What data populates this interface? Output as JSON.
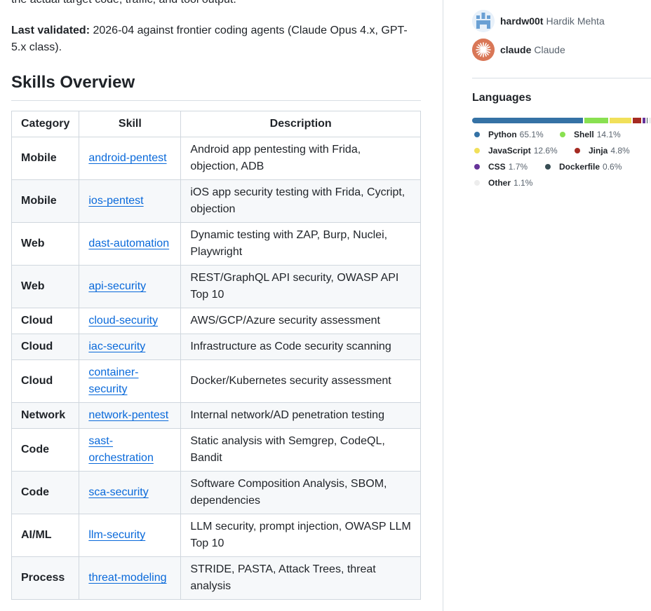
{
  "readme": {
    "cut_line": "the actual target code, traffic, and tool output.",
    "validated_label": "Last validated:",
    "validated_text": " 2026-04 against frontier coding agents (Claude Opus 4.x, GPT-5.x class).",
    "section_title": "Skills Overview",
    "table": {
      "headers": [
        "Category",
        "Skill",
        "Description"
      ],
      "rows": [
        {
          "category": "Mobile",
          "skill": "android-pentest",
          "description": "Android app pentesting with Frida, objection, ADB"
        },
        {
          "category": "Mobile",
          "skill": "ios-pentest",
          "description": "iOS app security testing with Frida, Cycript, objection"
        },
        {
          "category": "Web",
          "skill": "dast-automation",
          "description": "Dynamic testing with ZAP, Burp, Nuclei, Playwright"
        },
        {
          "category": "Web",
          "skill": "api-security",
          "description": "REST/GraphQL API security, OWASP API Top 10"
        },
        {
          "category": "Cloud",
          "skill": "cloud-security",
          "description": "AWS/GCP/Azure security assessment"
        },
        {
          "category": "Cloud",
          "skill": "iac-security",
          "description": "Infrastructure as Code security scanning"
        },
        {
          "category": "Cloud",
          "skill": "container-security",
          "description": "Docker/Kubernetes security assessment"
        },
        {
          "category": "Network",
          "skill": "network-pentest",
          "description": "Internal network/AD penetration testing"
        },
        {
          "category": "Code",
          "skill": "sast-orchestration",
          "description": "Static analysis with Semgrep, CodeQL, Bandit"
        },
        {
          "category": "Code",
          "skill": "sca-security",
          "description": "Software Composition Analysis, SBOM, dependencies"
        },
        {
          "category": "AI/ML",
          "skill": "llm-security",
          "description": "LLM security, prompt injection, OWASP LLM Top 10"
        },
        {
          "category": "Process",
          "skill": "threat-modeling",
          "description": "STRIDE, PASTA, Attack Trees, threat analysis"
        }
      ]
    }
  },
  "sidebar": {
    "contributors": [
      {
        "login": "hardw00t",
        "name": "Hardik Mehta",
        "avatar_icon": "identicon-avatar"
      },
      {
        "login": "claude",
        "name": "Claude",
        "avatar_icon": "claude-starburst-avatar"
      }
    ],
    "languages_title": "Languages",
    "languages": [
      {
        "name": "Python",
        "percent": "65.1%",
        "value": 65.1,
        "color": "#3572A5"
      },
      {
        "name": "Shell",
        "percent": "14.1%",
        "value": 14.1,
        "color": "#89e051"
      },
      {
        "name": "JavaScript",
        "percent": "12.6%",
        "value": 12.6,
        "color": "#f1e05a"
      },
      {
        "name": "Jinja",
        "percent": "4.8%",
        "value": 4.8,
        "color": "#a52a22"
      },
      {
        "name": "CSS",
        "percent": "1.7%",
        "value": 1.7,
        "color": "#663399"
      },
      {
        "name": "Dockerfile",
        "percent": "0.6%",
        "value": 0.6,
        "color": "#384d54"
      },
      {
        "name": "Other",
        "percent": "1.1%",
        "value": 1.1,
        "color": "#ededed"
      }
    ]
  }
}
